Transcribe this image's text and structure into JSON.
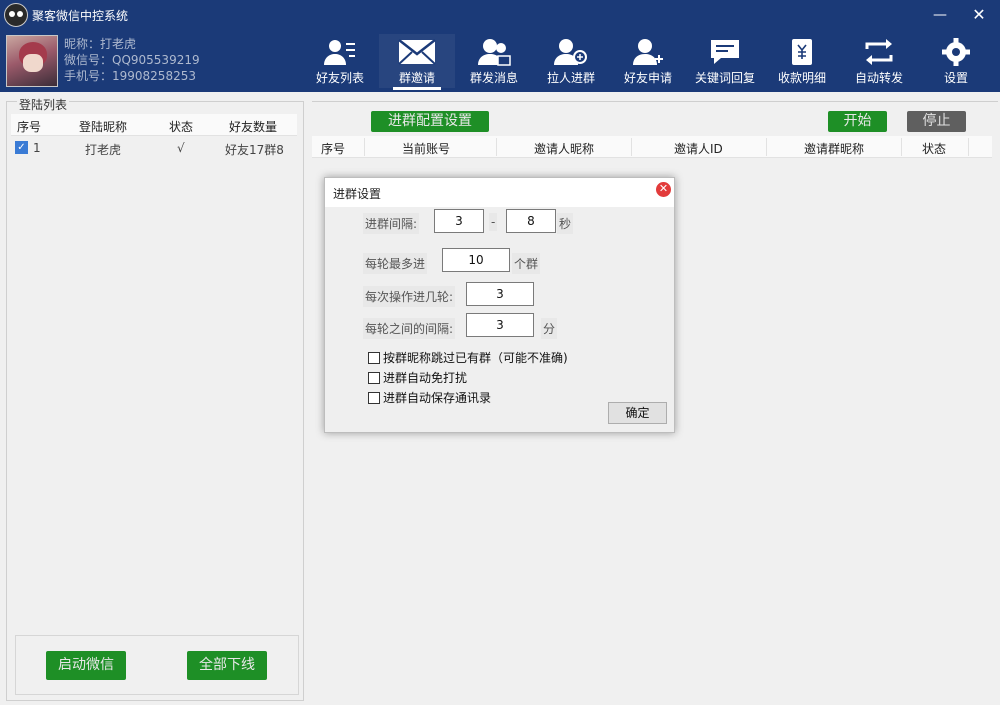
{
  "window": {
    "title": "聚客微信中控系统",
    "minimize": "—",
    "close": "✕"
  },
  "user": {
    "nickname": "昵称：打老虎",
    "wechat_id": "微信号：QQ905539219",
    "phone": "手机号：19908258253"
  },
  "nav": [
    {
      "label": "好友列表",
      "icon": "user-list-icon"
    },
    {
      "label": "群邀请",
      "icon": "group-invite-icon",
      "active": true
    },
    {
      "label": "群发消息",
      "icon": "group-message-icon"
    },
    {
      "label": "拉人进群",
      "icon": "pull-into-group-icon"
    },
    {
      "label": "好友申请",
      "icon": "add-friend-icon"
    },
    {
      "label": "关键词回复",
      "icon": "keyword-reply-icon"
    },
    {
      "label": "收款明细",
      "icon": "payment-detail-icon"
    },
    {
      "label": "自动转发",
      "icon": "auto-forward-icon"
    },
    {
      "label": "设置",
      "icon": "gear-icon"
    }
  ],
  "login_list": {
    "title": "登陆列表",
    "columns": [
      "序号",
      "登陆昵称",
      "状态",
      "好友数量"
    ],
    "rows": [
      {
        "index": "1",
        "nickname": "打老虎",
        "status": "√",
        "friends": "好友17群8",
        "checked": true
      }
    ],
    "start_wechat": "启动微信",
    "all_offline": "全部下线"
  },
  "right": {
    "config_button": "进群配置设置",
    "start_button": "开始",
    "stop_button": "停止",
    "columns": [
      "序号",
      "当前账号",
      "邀请人昵称",
      "邀请人ID",
      "邀请群昵称",
      "状态"
    ]
  },
  "dialog": {
    "title": "进群设置",
    "interval_label": "进群间隔:",
    "interval_min": "3",
    "dash": "-",
    "interval_max": "8",
    "sec_unit": "秒",
    "max_per_round_label": "每轮最多进",
    "max_per_round": "10",
    "group_unit": "个群",
    "rounds_label": "每次操作进几轮:",
    "rounds": "3",
    "round_gap_label": "每轮之间的间隔:",
    "round_gap": "3",
    "min_unit": "分",
    "options": [
      "按群昵称跳过已有群（可能不准确)",
      "进群自动免打扰",
      "进群自动保存通讯录"
    ],
    "ok": "确定"
  },
  "colors": {
    "header_bg": "#1b3a78",
    "accent_green": "#1e8f26",
    "close_red": "#e23b3b"
  }
}
